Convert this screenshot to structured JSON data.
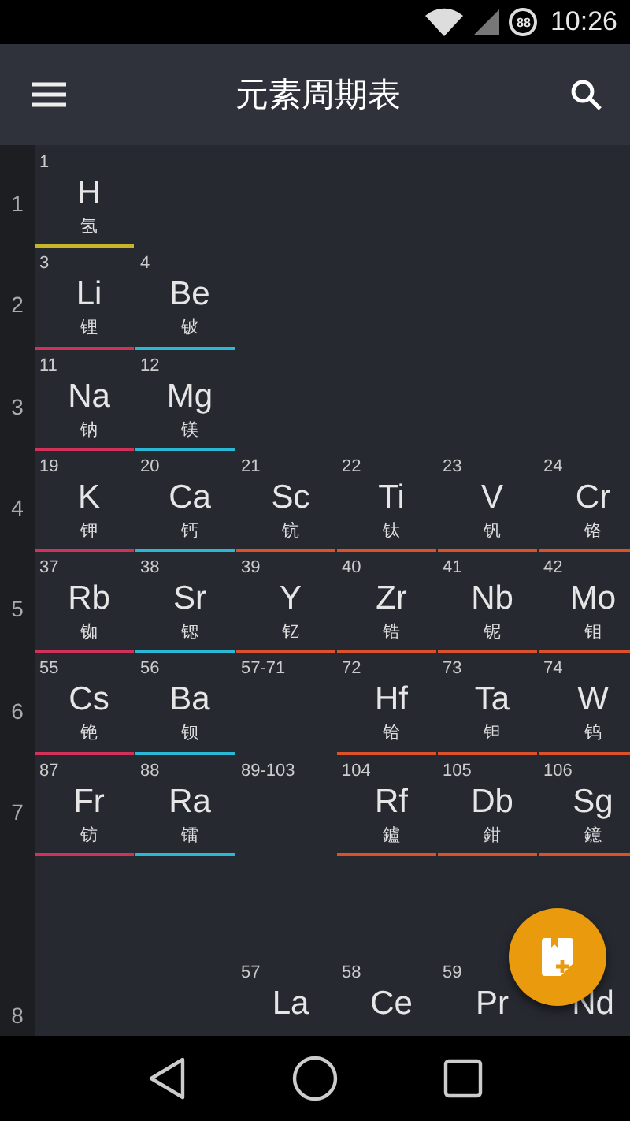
{
  "status_bar": {
    "battery": "88",
    "time": "10:26"
  },
  "app_bar": {
    "title": "元素周期表"
  },
  "rows": [
    {
      "label": "1",
      "cells": [
        {
          "kind": "element",
          "number": "1",
          "symbol": "H",
          "name": "氢",
          "color": "#c8b42a"
        }
      ]
    },
    {
      "label": "2",
      "cells": [
        {
          "kind": "element",
          "number": "3",
          "symbol": "Li",
          "name": "锂",
          "color": "#d2315a"
        },
        {
          "kind": "element",
          "number": "4",
          "symbol": "Be",
          "name": "铍",
          "color": "#2cb9d6"
        }
      ]
    },
    {
      "label": "3",
      "cells": [
        {
          "kind": "element",
          "number": "11",
          "symbol": "Na",
          "name": "钠",
          "color": "#d2315a"
        },
        {
          "kind": "element",
          "number": "12",
          "symbol": "Mg",
          "name": "镁",
          "color": "#2cb9d6"
        }
      ]
    },
    {
      "label": "4",
      "cells": [
        {
          "kind": "element",
          "number": "19",
          "symbol": "K",
          "name": "钾",
          "color": "#d2315a"
        },
        {
          "kind": "element",
          "number": "20",
          "symbol": "Ca",
          "name": "钙",
          "color": "#2cb9d6"
        },
        {
          "kind": "element",
          "number": "21",
          "symbol": "Sc",
          "name": "钪",
          "color": "#dd512a"
        },
        {
          "kind": "element",
          "number": "22",
          "symbol": "Ti",
          "name": "钛",
          "color": "#dd512a"
        },
        {
          "kind": "element",
          "number": "23",
          "symbol": "V",
          "name": "钒",
          "color": "#dd512a"
        },
        {
          "kind": "element",
          "number": "24",
          "symbol": "Cr",
          "name": "铬",
          "color": "#dd512a"
        }
      ]
    },
    {
      "label": "5",
      "cells": [
        {
          "kind": "element",
          "number": "37",
          "symbol": "Rb",
          "name": "铷",
          "color": "#d2315a"
        },
        {
          "kind": "element",
          "number": "38",
          "symbol": "Sr",
          "name": "锶",
          "color": "#2cb9d6"
        },
        {
          "kind": "element",
          "number": "39",
          "symbol": "Y",
          "name": "钇",
          "color": "#dd512a"
        },
        {
          "kind": "element",
          "number": "40",
          "symbol": "Zr",
          "name": "锆",
          "color": "#dd512a"
        },
        {
          "kind": "element",
          "number": "41",
          "symbol": "Nb",
          "name": "铌",
          "color": "#dd512a"
        },
        {
          "kind": "element",
          "number": "42",
          "symbol": "Mo",
          "name": "钼",
          "color": "#dd512a"
        }
      ]
    },
    {
      "label": "6",
      "cells": [
        {
          "kind": "element",
          "number": "55",
          "symbol": "Cs",
          "name": "铯",
          "color": "#d2315a"
        },
        {
          "kind": "element",
          "number": "56",
          "symbol": "Ba",
          "name": "钡",
          "color": "#2cb9d6"
        },
        {
          "kind": "series",
          "number": "57-71"
        },
        {
          "kind": "element",
          "number": "72",
          "symbol": "Hf",
          "name": "铪",
          "color": "#dd512a"
        },
        {
          "kind": "element",
          "number": "73",
          "symbol": "Ta",
          "name": "钽",
          "color": "#dd512a"
        },
        {
          "kind": "element",
          "number": "74",
          "symbol": "W",
          "name": "钨",
          "color": "#dd512a"
        }
      ]
    },
    {
      "label": "7",
      "cells": [
        {
          "kind": "element",
          "number": "87",
          "symbol": "Fr",
          "name": "钫",
          "color": "#d2315a"
        },
        {
          "kind": "element",
          "number": "88",
          "symbol": "Ra",
          "name": "镭",
          "color": "#2cb9d6"
        },
        {
          "kind": "series",
          "number": "89-103"
        },
        {
          "kind": "element",
          "number": "104",
          "symbol": "Rf",
          "name": "鑪",
          "color": "#dd512a"
        },
        {
          "kind": "element",
          "number": "105",
          "symbol": "Db",
          "name": "鉗",
          "color": "#dd512a"
        },
        {
          "kind": "element",
          "number": "106",
          "symbol": "Sg",
          "name": "鐿",
          "color": "#dd512a"
        }
      ]
    },
    {
      "label": "8",
      "cells": [
        {
          "kind": "blank"
        },
        {
          "kind": "blank"
        },
        {
          "kind": "element",
          "number": "57",
          "symbol": "La"
        },
        {
          "kind": "element",
          "number": "58",
          "symbol": "Ce"
        },
        {
          "kind": "element",
          "number": "59",
          "symbol": "Pr"
        },
        {
          "kind": "element",
          "symbol": "Nd"
        }
      ]
    }
  ]
}
